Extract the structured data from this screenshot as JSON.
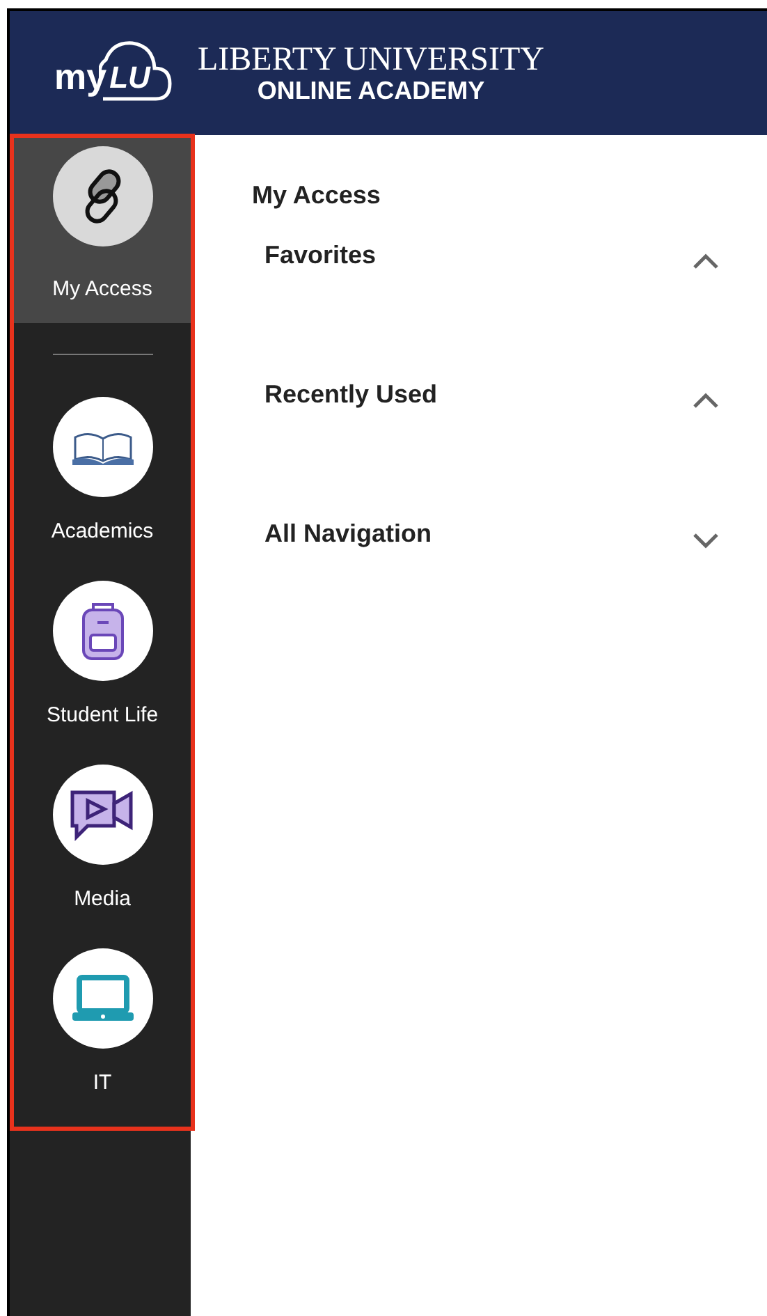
{
  "header": {
    "logo_text": "my",
    "logo_mark": "LU",
    "title_line1": "LIBERTY UNIVERSITY",
    "title_line2": "ONLINE ACADEMY"
  },
  "sidebar": {
    "items": [
      {
        "label": "My Access",
        "kind": "link",
        "selected": true
      },
      {
        "label": "Academics",
        "kind": "book",
        "selected": false
      },
      {
        "label": "Student Life",
        "kind": "backpack",
        "selected": false
      },
      {
        "label": "Media",
        "kind": "video",
        "selected": false
      },
      {
        "label": "IT",
        "kind": "laptop",
        "selected": false
      }
    ]
  },
  "main": {
    "title": "My Access",
    "sections": [
      {
        "label": "Favorites",
        "expanded": true
      },
      {
        "label": "Recently Used",
        "expanded": true
      },
      {
        "label": "All Navigation",
        "expanded": false
      }
    ]
  }
}
